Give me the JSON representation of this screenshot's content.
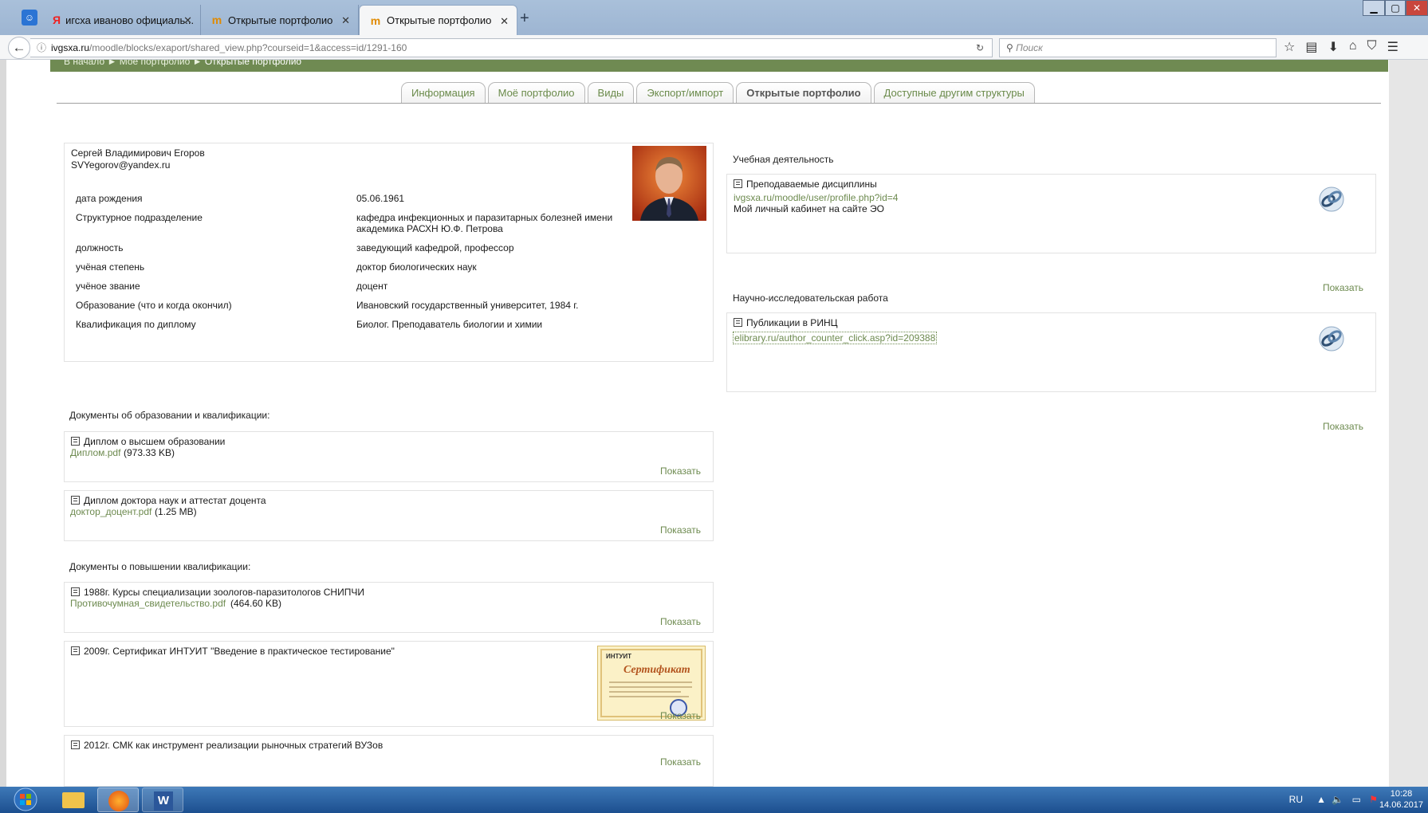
{
  "browser": {
    "tabs": [
      {
        "label": "игсха иваново официаль...",
        "active": false
      },
      {
        "label": "Открытые портфолио",
        "active": false
      },
      {
        "label": "Открытые портфолио",
        "active": true
      }
    ],
    "new_tab": "+",
    "url_domain": "ivgsxa.ru",
    "url_path": "/moodle/blocks/exaport/shared_view.php?courseid=1&access=id/1291-160",
    "search_placeholder": "Поиск"
  },
  "breadcrumb": {
    "home": "В начало",
    "sep": "►",
    "portfolio": "Моё портфолио",
    "current": "Открытые портфолио"
  },
  "tabs": [
    {
      "label": "Информация"
    },
    {
      "label": "Моё портфолио"
    },
    {
      "label": "Виды"
    },
    {
      "label": "Экспорт/импорт"
    },
    {
      "label": "Открытые портфолио",
      "active": true
    },
    {
      "label": "Доступные другим структуры"
    }
  ],
  "profile": {
    "name": "Сергей Владимирович Егоров",
    "email": "SVYegorov@yandex.ru",
    "fields": [
      {
        "label": "дата рождения",
        "value": "05.06.1961"
      },
      {
        "label": "Структурное подразделение",
        "value": "кафедра инфекционных и паразитарных болезней имени",
        "value2": "академика РАСХН Ю.Ф. Петрова"
      },
      {
        "label": "должность",
        "value": "заведующий кафедрой, профессор"
      },
      {
        "label": "учёная степень",
        "value": "доктор биологических наук"
      },
      {
        "label": "учёное звание",
        "value": "доцент"
      },
      {
        "label": "Образование (что и когда окончил)",
        "value": "Ивановский государственный университет, 1984 г."
      },
      {
        "label": "Квалификация по диплому",
        "value": "Биолог. Преподаватель биологии и химии"
      }
    ]
  },
  "show_label": "Показать",
  "sections": {
    "edu_docs": "Документы об образовании и квалификации:",
    "qual_docs": "Документы о повышении квалификации:",
    "teaching": "Учебная деятельность",
    "research": "Научно-исследовательская работа"
  },
  "edu_items": [
    {
      "title": "Диплом о высшем образовании",
      "file": "Диплом.pdf",
      "size": "(973.33 KB)"
    },
    {
      "title": "Диплом доктора наук и аттестат доцента",
      "file": "доктор_доцент.pdf",
      "size": "(1.25 MB)"
    }
  ],
  "qual_items": [
    {
      "title": "1988г. Курсы специализации зоологов-паразитологов СНИПЧИ",
      "file": "Противочумная_свидетельство.pdf",
      "size": "(464.60 KB)"
    },
    {
      "title": "2009г. Сертификат ИНТУИТ \"Введение в практическое тестирование\"",
      "cert_brand": "ИНТУИТ",
      "cert_title": "Сертификат"
    },
    {
      "title": "2012г. СМК как инструмент реализации рыночных стратегий ВУЗов"
    }
  ],
  "teaching_item": {
    "title": "Преподаваемые дисциплины",
    "url": "ivgsxa.ru/moodle/user/profile.php?id=4",
    "desc": "Мой личный кабинет на сайте ЭО"
  },
  "research_item": {
    "title": "Публикации в РИНЦ",
    "url": "elibrary.ru/author_counter_click.asp?id=209388"
  },
  "taskbar": {
    "lang": "RU",
    "time": "10:28",
    "date": "14.06.2017"
  },
  "colors": {
    "accent_green": "#6f8a52",
    "link_green": "#6d8a4f"
  }
}
